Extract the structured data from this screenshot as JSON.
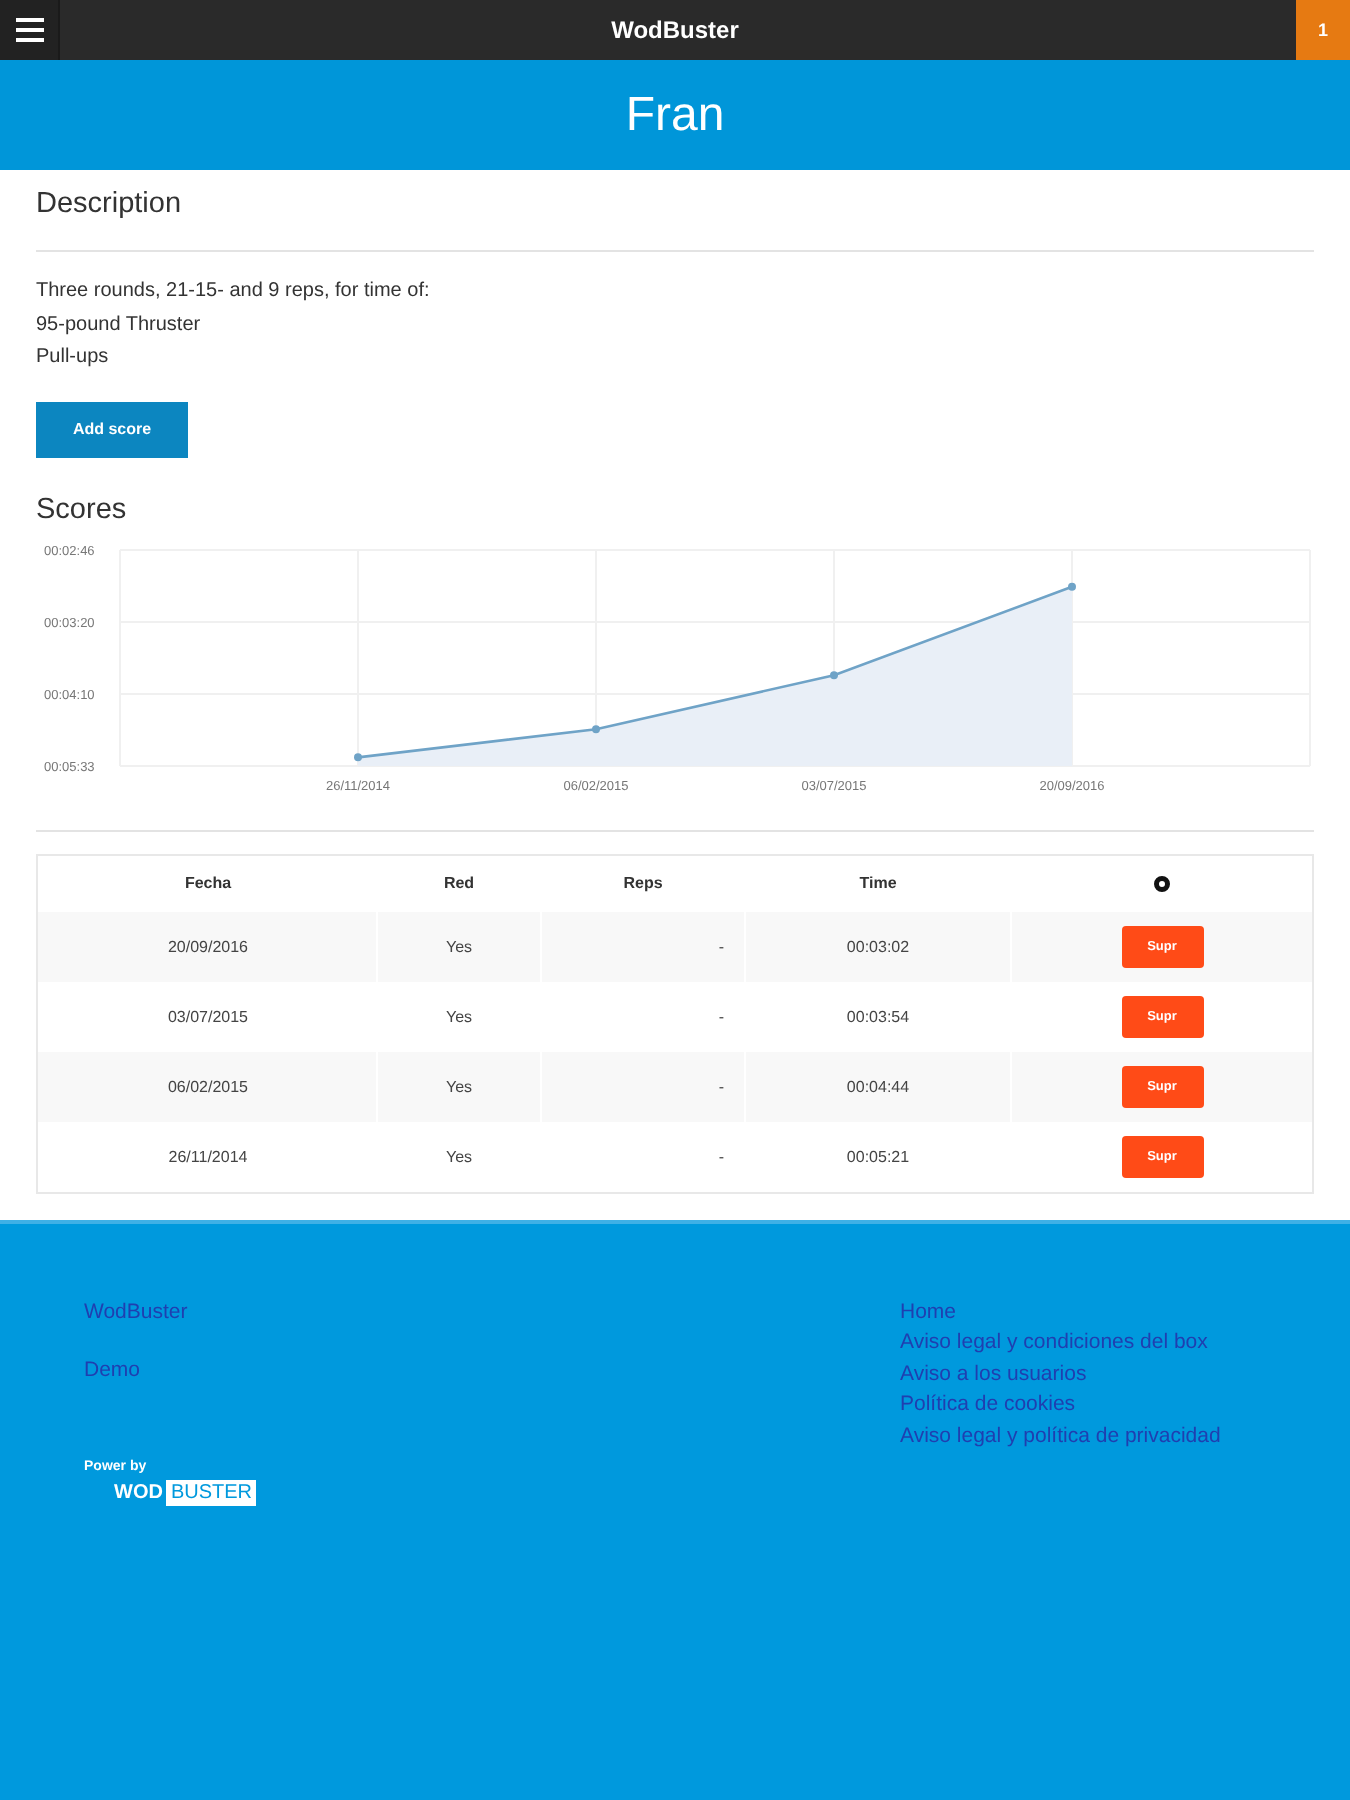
{
  "top_bar": {
    "title": "WodBuster",
    "badge": "1"
  },
  "header": {
    "title": "Fran"
  },
  "description": {
    "heading": "Description",
    "lines": [
      "Three rounds, 21-15- and 9 reps, for time of:",
      "95-pound Thruster",
      "Pull-ups"
    ],
    "button": "Add score"
  },
  "scores": {
    "heading": "Scores",
    "chart": {
      "y_labels": [
        "00:02:46",
        "00:03:20",
        "00:04:10",
        "00:05:33"
      ],
      "x_labels": [
        "26/11/2014",
        "06/02/2015",
        "03/07/2015",
        "20/09/2016"
      ]
    }
  },
  "table": {
    "columns": [
      "Fecha",
      "Red",
      "Reps",
      "Time"
    ],
    "rows": [
      {
        "fecha": "20/09/2016",
        "red": "Yes",
        "reps": "-",
        "time": "00:03:02",
        "action": "Supr"
      },
      {
        "fecha": "03/07/2015",
        "red": "Yes",
        "reps": "-",
        "time": "00:03:54",
        "action": "Supr"
      },
      {
        "fecha": "06/02/2015",
        "red": "Yes",
        "reps": "-",
        "time": "00:04:44",
        "action": "Supr"
      },
      {
        "fecha": "26/11/2014",
        "red": "Yes",
        "reps": "-",
        "time": "00:05:21",
        "action": "Supr"
      }
    ]
  },
  "footer": {
    "left_links": [
      "WodBuster",
      "Demo"
    ],
    "powered_by": "Power by",
    "logo": {
      "left": "WOD",
      "right": "BUSTER"
    },
    "right_links": [
      "Home",
      "Aviso legal y condiciones del box",
      "Aviso a los usuarios",
      "Política de cookies",
      "Aviso legal y política de privacidad"
    ]
  }
}
